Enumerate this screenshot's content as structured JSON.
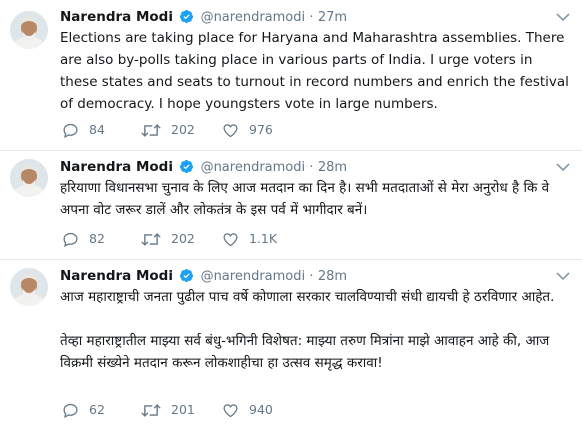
{
  "tweets": [
    {
      "name": "Narendra Modi",
      "handle": "@narendramodi",
      "separator": "·",
      "time": "27m",
      "text": "Elections are taking place for Haryana and Maharashtra assemblies. There are also by-polls taking place in various parts of India. I urge voters in these states and seats to turnout in record numbers and enrich the festival of democracy. I hope youngsters vote in large numbers.",
      "replies": "84",
      "retweets": "202",
      "likes": "976"
    },
    {
      "name": "Narendra Modi",
      "handle": "@narendramodi",
      "separator": "·",
      "time": "28m",
      "text": "हरियाणा विधानसभा चुनाव के लिए आज मतदान का दिन है। सभी मतदाताओं से मेरा अनुरोध है कि वे अपना वोट जरूर डालें और लोकतंत्र के इस पर्व में भागीदार बनें।",
      "replies": "82",
      "retweets": "202",
      "likes": "1.1K"
    },
    {
      "name": "Narendra Modi",
      "handle": "@narendramodi",
      "separator": "·",
      "time": "28m",
      "text": "आज महाराष्ट्राची जनता पुढील पाच वर्षे कोणाला सरकार चालविण्याची संधी द्यायची हे ठरविणार आहेत.\n\nतेव्हा महाराष्ट्रातील माझ्या सर्व बंधु-भगिनी विशेषत: माझ्या तरुण मित्रांना माझे आवाहन आहे की, आज विक्रमी संख्येने मतदान करून लोकशाहीचा हा उत्सव समृद्ध करावा!",
      "replies": "62",
      "retweets": "201",
      "likes": "940"
    }
  ],
  "colors": {
    "verified": "#1da1f2",
    "muted": "#657786",
    "text": "#14171a",
    "divider": "#e6ecf0"
  },
  "icons": {
    "verified": "verified-badge-icon",
    "reply": "reply-icon",
    "retweet": "retweet-icon",
    "like": "heart-icon",
    "menu": "chevron-down-icon",
    "avatar": "profile-photo"
  }
}
